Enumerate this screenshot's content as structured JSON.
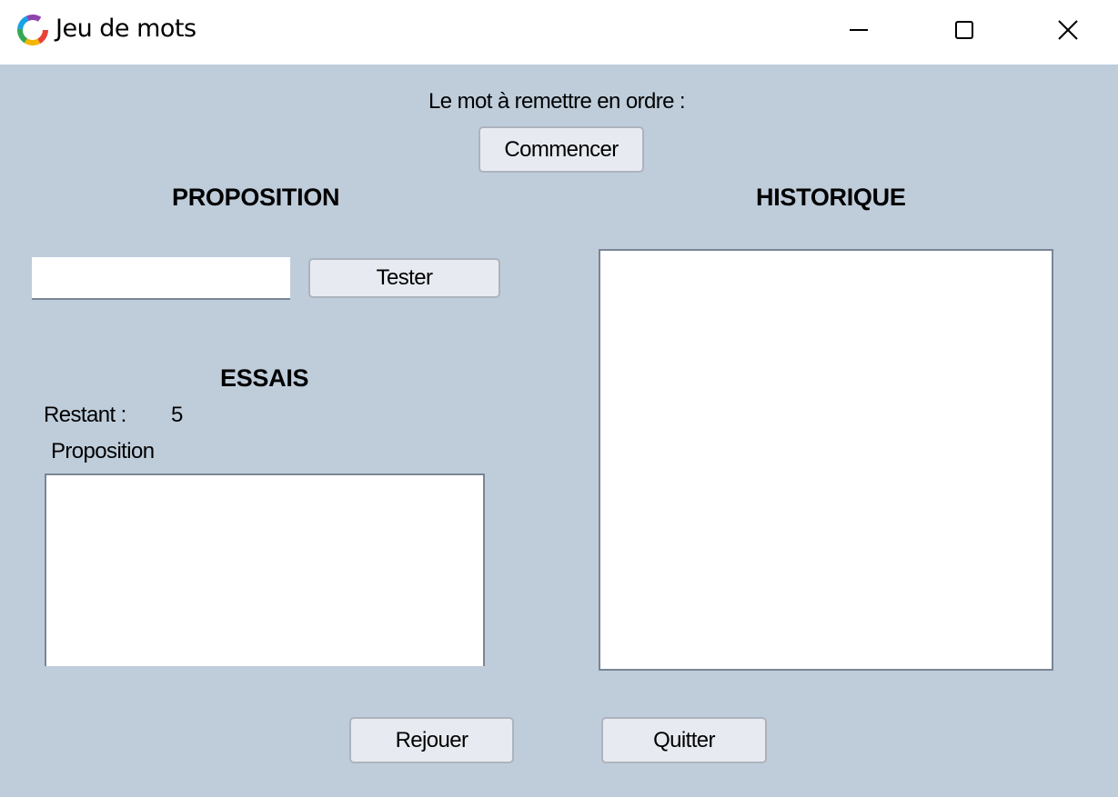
{
  "window": {
    "title": "Jeu de mots",
    "controls": [
      "minimize-icon",
      "maximize-icon",
      "close-icon"
    ]
  },
  "header": {
    "prompt_label": "Le mot à remettre en ordre :",
    "start_button": "Commencer"
  },
  "proposition": {
    "heading": "PROPOSITION",
    "input_value": "",
    "test_button": "Tester"
  },
  "essais": {
    "heading": "ESSAIS",
    "remaining_label": "Restant :",
    "remaining_value": "5",
    "list_header": "Proposition",
    "items": []
  },
  "historique": {
    "heading": "HISTORIQUE",
    "items": []
  },
  "footer": {
    "replay_button": "Rejouer",
    "quit_button": "Quitter"
  },
  "colors": {
    "background": "#bfcddb",
    "button_face": "#e7ebf1",
    "panel": "#ffffff"
  }
}
